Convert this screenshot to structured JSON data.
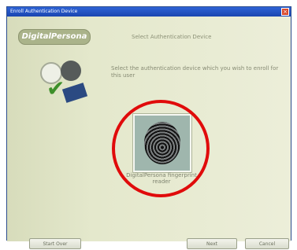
{
  "window": {
    "title": "Enroll Authentication Device",
    "close_glyph": "×"
  },
  "header": {
    "logo_text": "DigitalPersona",
    "title": "Select Authentication Device"
  },
  "instruction": "Select the authentication device which you wish to enroll for this user",
  "device": {
    "label": "DigitalPersona fingerprint reader"
  },
  "buttons": {
    "left": "Start Over",
    "next": "Next",
    "cancel": "Cancel"
  },
  "colors": {
    "highlight_circle": "#e00b0b",
    "titlebar": "#1a45b0"
  }
}
